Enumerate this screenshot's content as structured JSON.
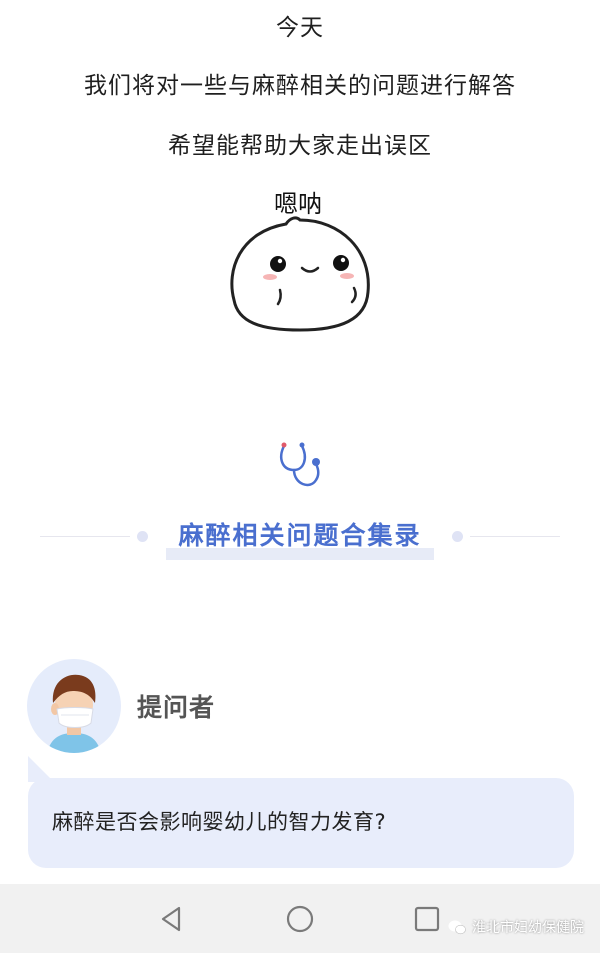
{
  "intro": {
    "line1": "今天",
    "line2": "我们将对一些与麻醉相关的问题进行解答",
    "line3": "希望能帮助大家走出误区"
  },
  "sticker": {
    "caption": "嗯呐"
  },
  "section": {
    "title": "麻醉相关问题合集录"
  },
  "qa": {
    "asker_label": "提问者",
    "question": "麻醉是否会影响婴幼儿的智力发育?"
  },
  "navbar": {
    "back_icon": "triangle-back-icon",
    "home_icon": "circle-home-icon",
    "recent_icon": "square-recent-icon"
  },
  "watermark": {
    "text": "淮北市妇幼保健院"
  },
  "colors": {
    "accent": "#4a6fcf",
    "bubble_bg": "#e8edfb",
    "navbar_bg": "#f1f1f1"
  }
}
